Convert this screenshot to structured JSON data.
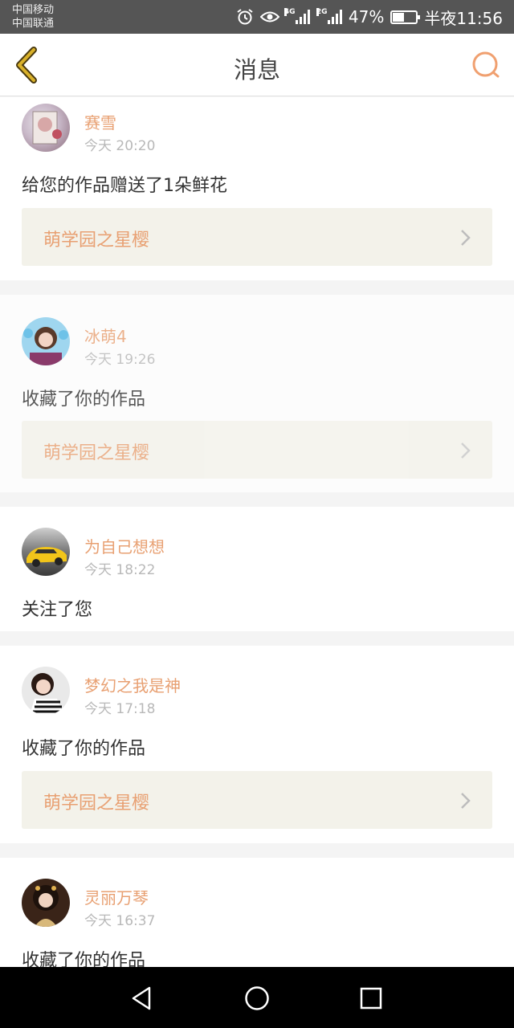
{
  "status_bar": {
    "carrier1": "中国移动",
    "carrier2": "中国联通",
    "net1": "4G",
    "net2": "2G",
    "battery": "47%",
    "battery_level": 0.47,
    "time": "半夜11:56",
    "icons": [
      "alarm-icon",
      "eye-icon",
      "signal-icon",
      "battery-icon"
    ]
  },
  "header": {
    "title": "消息",
    "back_icon": "chevron-left-icon",
    "search_icon": "search-icon"
  },
  "colors": {
    "accent": "#e8a072",
    "back_arrow": "#c9a227",
    "work_bg": "#f3f2ea",
    "status_bar": "#555555"
  },
  "messages": [
    {
      "name": "赛雪",
      "time": "今天 20:20",
      "action": "给您的作品赠送了1朵鲜花",
      "work": "萌学园之星樱"
    },
    {
      "name": "冰萌4",
      "time": "今天 19:26",
      "action": "收藏了你的作品",
      "work": "萌学园之星樱"
    },
    {
      "name": "为自己想想",
      "time": "今天 18:22",
      "action": "关注了您"
    },
    {
      "name": "梦幻之我是神",
      "time": "今天 17:18",
      "action": "收藏了你的作品",
      "work": "萌学园之星樱"
    },
    {
      "name": "灵丽万琴",
      "time": "今天 16:37",
      "action": "收藏了你的作品"
    }
  ],
  "nav": {
    "back_icon": "triangle-back-icon",
    "home_icon": "circle-home-icon",
    "recents_icon": "square-recents-icon"
  }
}
